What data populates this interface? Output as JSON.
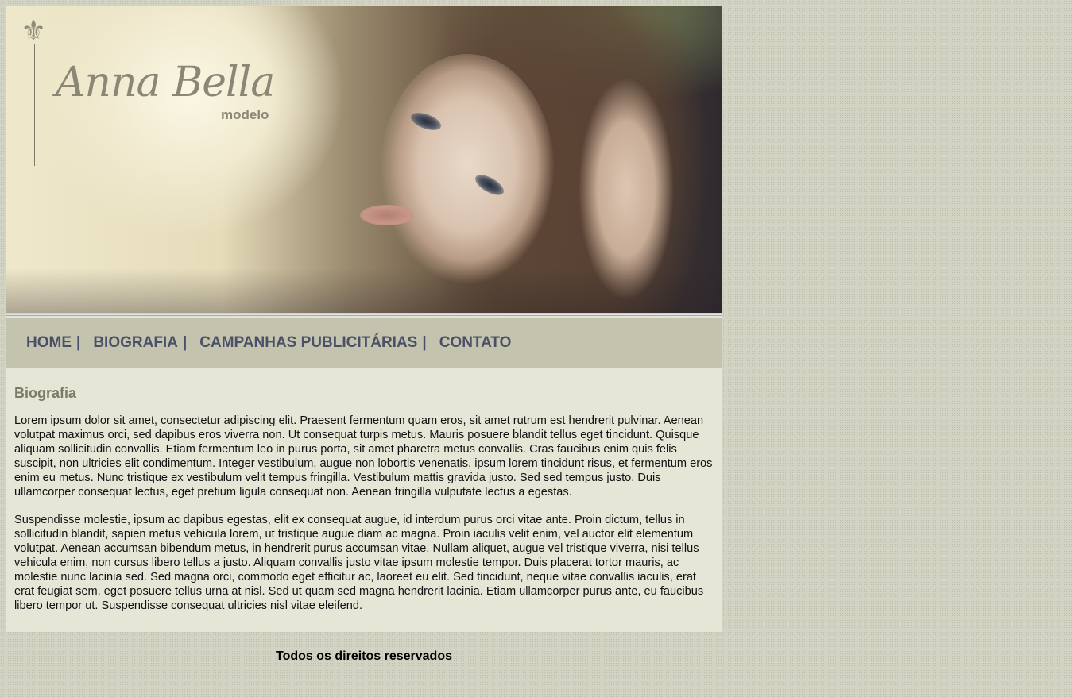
{
  "colors": {
    "page_background": "#d2d3c3",
    "nav_background": "#c3c3ae",
    "nav_text": "#4b5068",
    "content_background": "#e6e6d6",
    "heading_text": "#7b7b69",
    "logo_text": "#8a8777"
  },
  "banner": {
    "logo_name": "Anna Bella",
    "logo_subtitle": "modelo",
    "logo_icon": "fleur-de-lis-icon",
    "photo": "model-portrait"
  },
  "nav": {
    "items": [
      {
        "label": "HOME"
      },
      {
        "label": "BIOGRAFIA"
      },
      {
        "label": "CAMPANHAS PUBLICITÁRIAS"
      },
      {
        "label": "CONTATO"
      }
    ],
    "separator": "|"
  },
  "content": {
    "title": "Biografia",
    "paragraphs": [
      "Lorem ipsum dolor sit amet, consectetur adipiscing elit. Praesent fermentum quam eros, sit amet rutrum est hendrerit pulvinar. Aenean volutpat maximus orci, sed dapibus eros viverra non. Ut consequat turpis metus. Mauris posuere blandit tellus eget tincidunt. Quisque aliquam sollicitudin convallis. Etiam fermentum leo in purus porta, sit amet pharetra metus convallis. Cras faucibus enim quis felis suscipit, non ultricies elit condimentum. Integer vestibulum, augue non lobortis venenatis, ipsum lorem tincidunt risus, et fermentum eros enim eu metus. Nunc tristique ex vestibulum velit tempus fringilla. Vestibulum mattis gravida justo. Sed sed tempus justo. Duis ullamcorper consequat lectus, eget pretium ligula consequat non. Aenean fringilla vulputate lectus a egestas.",
      "Suspendisse molestie, ipsum ac dapibus egestas, elit ex consequat augue, id interdum purus orci vitae ante. Proin dictum, tellus in sollicitudin blandit, sapien metus vehicula lorem, ut tristique augue diam ac magna. Proin iaculis velit enim, vel auctor elit elementum volutpat. Aenean accumsan bibendum metus, in hendrerit purus accumsan vitae. Nullam aliquet, augue vel tristique viverra, nisi tellus vehicula enim, non cursus libero tellus a justo. Aliquam convallis justo vitae ipsum molestie tempor. Duis placerat tortor mauris, ac molestie nunc lacinia sed. Sed magna orci, commodo eget efficitur ac, laoreet eu elit. Sed tincidunt, neque vitae convallis iaculis, erat erat feugiat sem, eget posuere tellus urna at nisl. Sed ut quam sed magna hendrerit lacinia. Etiam ullamcorper purus ante, eu faucibus libero tempor ut. Suspendisse consequat ultricies nisl vitae eleifend."
    ]
  },
  "footer": {
    "text": "Todos os direitos reservados"
  }
}
